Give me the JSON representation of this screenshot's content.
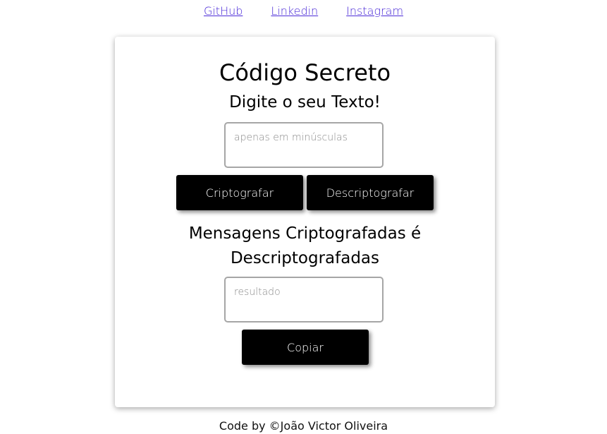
{
  "nav": {
    "links": [
      {
        "label": "GitHub"
      },
      {
        "label": "Linkedin"
      },
      {
        "label": "Instagram"
      }
    ],
    "link_color": "#4b2bd8"
  },
  "card": {
    "title": "Código Secreto",
    "subtitle": "Digite o seu Texto!",
    "input": {
      "placeholder": "apenas em minúsculas",
      "value": ""
    },
    "buttons": {
      "encrypt_label": "Criptografar",
      "decrypt_label": "Descriptografar",
      "copy_label": "Copiar"
    },
    "messages_title": "Mensagens Criptografadas é Descriptografadas",
    "output": {
      "placeholder": "resultado",
      "value": ""
    }
  },
  "footer": {
    "text": "Code by ©João Victor Oliveira"
  },
  "colors": {
    "button_bg": "#000000",
    "button_text": "#ffffff",
    "textarea_border": "#a6a6a6"
  }
}
